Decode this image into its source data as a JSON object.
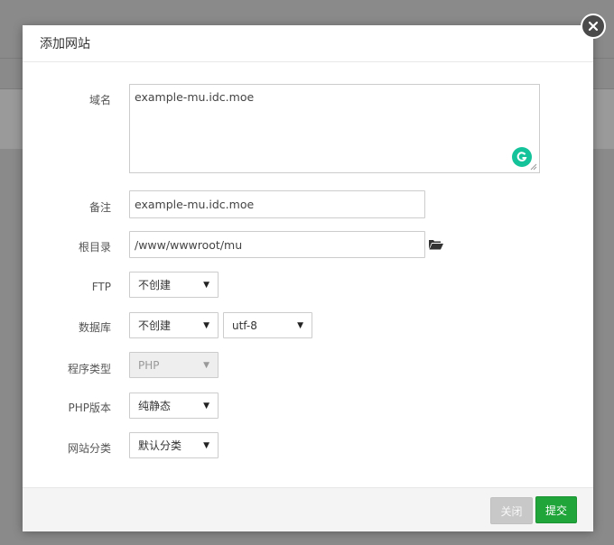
{
  "dialog": {
    "title": "添加网站",
    "fields": {
      "domain": {
        "label": "域名",
        "value": "example-mu.idc.moe"
      },
      "remark": {
        "label": "备注",
        "value": "example-mu.idc.moe"
      },
      "root_dir": {
        "label": "根目录",
        "value": "/www/wwwroot/mu"
      },
      "ftp": {
        "label": "FTP",
        "selected": "不创建"
      },
      "database": {
        "label": "数据库",
        "selected": "不创建",
        "charset": "utf-8"
      },
      "program_type": {
        "label": "程序类型",
        "selected": "PHP",
        "disabled": true
      },
      "php_version": {
        "label": "PHP版本",
        "selected": "纯静态"
      },
      "site_category": {
        "label": "网站分类",
        "selected": "默认分类"
      }
    },
    "buttons": {
      "close": "关闭",
      "submit": "提交"
    }
  },
  "icons": {
    "close": "close-icon",
    "folder": "folder-open-icon",
    "grammarly": "grammarly-icon",
    "caret": "caret-down-icon"
  },
  "colors": {
    "submit": "#20a53a",
    "grammarly": "#15c39a"
  }
}
